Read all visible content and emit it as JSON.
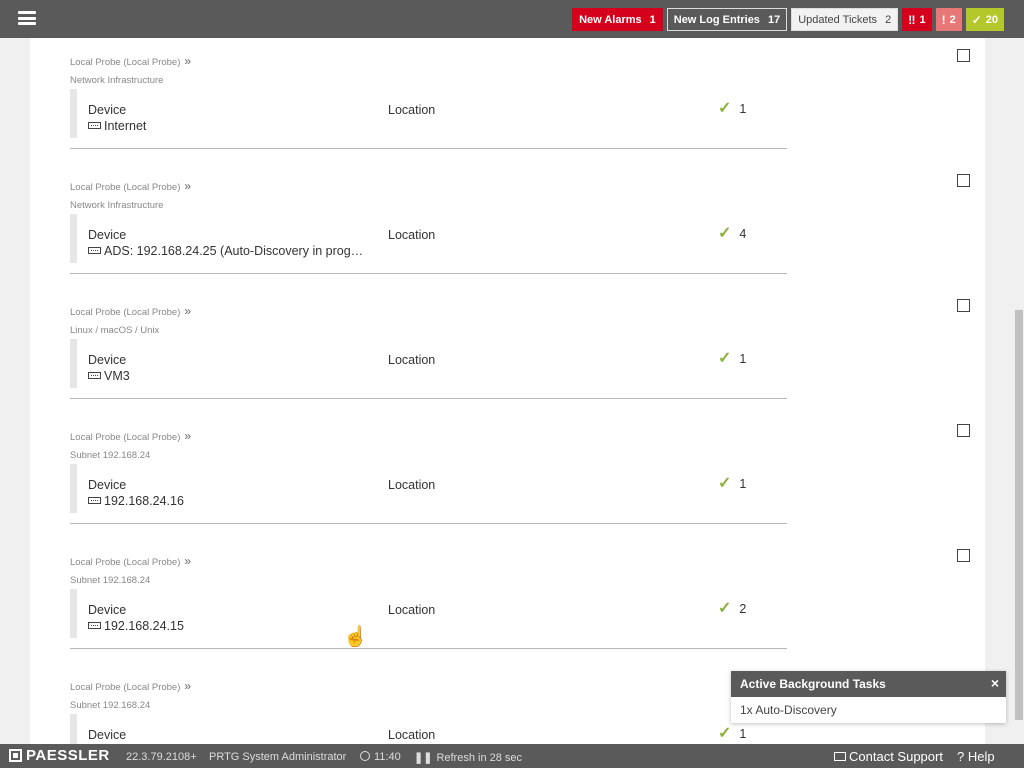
{
  "topbar": {
    "menu_icon": "hamburger-menu-icon",
    "badges": {
      "new_alarms": {
        "label": "New Alarms",
        "count": "1"
      },
      "new_log": {
        "label": "New Log Entries",
        "count": "17"
      },
      "updated_tickets": {
        "label": "Updated Tickets",
        "count": "2"
      },
      "down": {
        "icon": "‼",
        "count": "1"
      },
      "warning": {
        "icon": "!",
        "count": "2"
      },
      "up": {
        "icon": "✓",
        "count": "20"
      }
    },
    "colors": {
      "alarm": "#d5001c",
      "warning": "#e87878",
      "ok": "#b4c82b"
    }
  },
  "entries": [
    {
      "probe": "Local Probe (Local Probe)",
      "group": "Network Infrastructure",
      "device_label": "Device",
      "device_name": "Internet",
      "location_label": "Location",
      "sensor_count": "1"
    },
    {
      "probe": "Local Probe (Local Probe)",
      "group": "Network Infrastructure",
      "device_label": "Device",
      "device_name": "ADS: 192.168.24.25 (Auto-Discovery in prog…",
      "location_label": "Location",
      "sensor_count": "4"
    },
    {
      "probe": "Local Probe (Local Probe)",
      "group": "Linux / macOS / Unix",
      "device_label": "Device",
      "device_name": "VM3",
      "location_label": "Location",
      "sensor_count": "1"
    },
    {
      "probe": "Local Probe (Local Probe)",
      "group": "Subnet 192.168.24",
      "device_label": "Device",
      "device_name": "192.168.24.16",
      "location_label": "Location",
      "sensor_count": "1"
    },
    {
      "probe": "Local Probe (Local Probe)",
      "group": "Subnet 192.168.24",
      "device_label": "Device",
      "device_name": "192.168.24.15",
      "location_label": "Location",
      "sensor_count": "2"
    },
    {
      "probe": "Local Probe (Local Probe)",
      "group": "Subnet 192.168.24",
      "device_label": "Device",
      "device_name": "",
      "location_label": "Location",
      "sensor_count": "1"
    }
  ],
  "background_tasks": {
    "title": "Active Background Tasks",
    "close": "×",
    "item": "1x Auto-Discovery"
  },
  "footer": {
    "logo": "PAESSLER",
    "version": "22.3.79.2108+",
    "user": "PRTG System Administrator",
    "time": "11:40",
    "refresh": "Refresh in 28 sec",
    "contact": "Contact Support",
    "help": "Help"
  }
}
